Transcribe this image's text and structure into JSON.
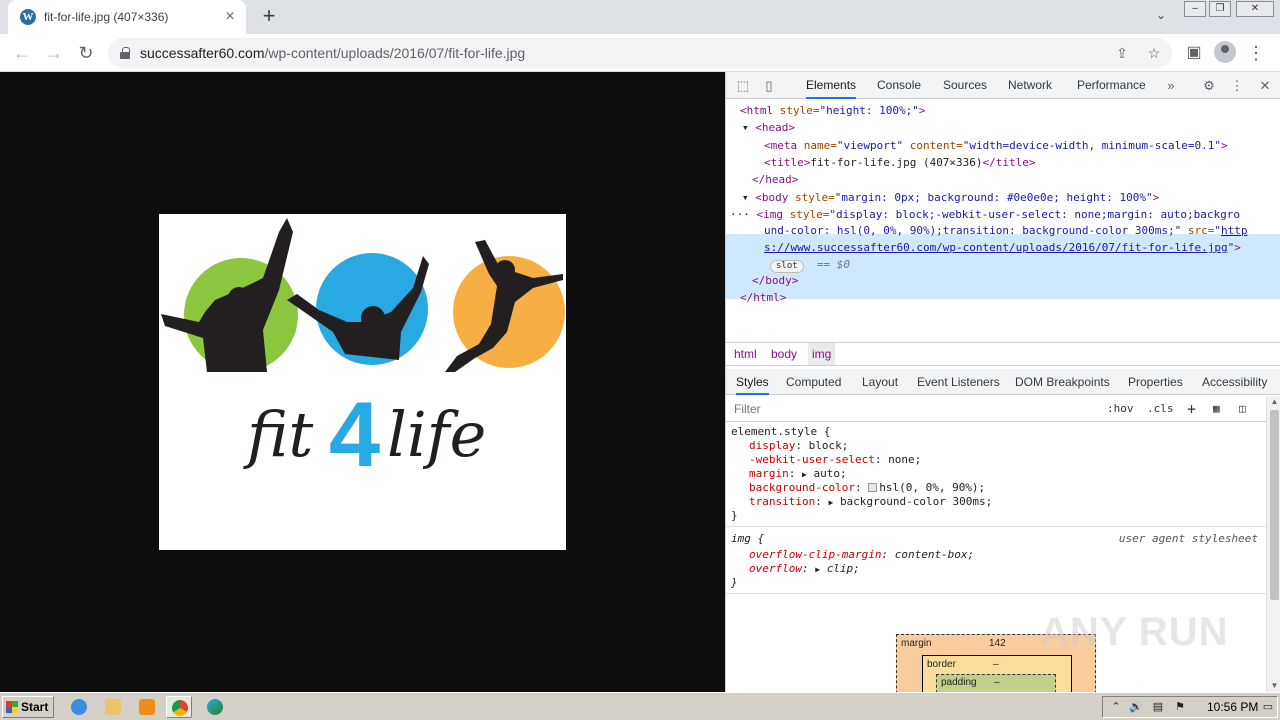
{
  "tab": {
    "title": "fit-for-life.jpg (407×336)",
    "favicon": "wordpress-icon"
  },
  "address": {
    "host": "successafter60.com",
    "path": "/wp-content/uploads/2016/07/fit-for-life.jpg"
  },
  "image": {
    "text_left": "fit",
    "text_number": "4",
    "text_right": "life",
    "circle_colors": [
      "#8cc63f",
      "#29a9e1",
      "#f7ae42"
    ]
  },
  "devtools": {
    "tabs": [
      "Elements",
      "Console",
      "Sources",
      "Network",
      "Performance"
    ],
    "dom": {
      "html_open_tag": "<html",
      "html_style_attr": " style=",
      "html_style_val": "\"height: 100%;\"",
      "head_open": "<head>",
      "meta_tag": "<meta",
      "meta_name_attr": " name=",
      "meta_name_val": "\"viewport\"",
      "meta_content_attr": " content=",
      "meta_content_val": "\"width=device-width, minimum-scale=0.1\"",
      "title_open": "<title>",
      "title_text": "fit-for-life.jpg (407×336)",
      "title_close": "</title>",
      "head_close": "</head>",
      "body_open": "<body",
      "body_style_val": "\"margin: 0px; background: #0e0e0e; height: 100%\"",
      "img_line1": "\"display: block;-webkit-user-select: none;margin: auto;backgro",
      "img_line2": "und-color: hsl(0, 0%, 90%);transition: background-color 300ms;\"",
      "img_src_start": "http",
      "img_src_rest": "s://www.successafter60.com/wp-content/uploads/2016/07/fit-for-life.jpg",
      "slot": "slot",
      "dollar0": "== $0",
      "body_close": "</body>",
      "html_close": "</html>"
    },
    "breadcrumbs": [
      "html",
      "body",
      "img"
    ],
    "subtabs": [
      "Styles",
      "Computed",
      "Layout",
      "Event Listeners",
      "DOM Breakpoints",
      "Properties",
      "Accessibility"
    ],
    "filter_placeholder": "Filter",
    "hov": ":hov",
    "cls": ".cls",
    "styles": {
      "element_selector": "element.style {",
      "props": [
        {
          "name": "display",
          "value": "block;"
        },
        {
          "name": "-webkit-user-select",
          "value": "none;"
        },
        {
          "name": "margin",
          "value": "auto;"
        },
        {
          "name": "background-color",
          "value": "hsl(0, 0%, 90%);"
        },
        {
          "name": "transition",
          "value": "background-color 300ms;"
        }
      ],
      "close": "}",
      "ua_selector": "img {",
      "ua_label": "user agent stylesheet",
      "ua_props": [
        {
          "name": "overflow-clip-margin",
          "value": "content-box;"
        },
        {
          "name": "overflow",
          "value": "clip;"
        }
      ]
    },
    "boxmodel": {
      "margin_label": "margin",
      "margin_value": "142",
      "border_label": "border",
      "border_value": "–",
      "padding_label": "padding",
      "padding_value": "–"
    }
  },
  "watermark": "ANY RUN",
  "taskbar": {
    "start": "Start",
    "time": "10:56 PM"
  }
}
